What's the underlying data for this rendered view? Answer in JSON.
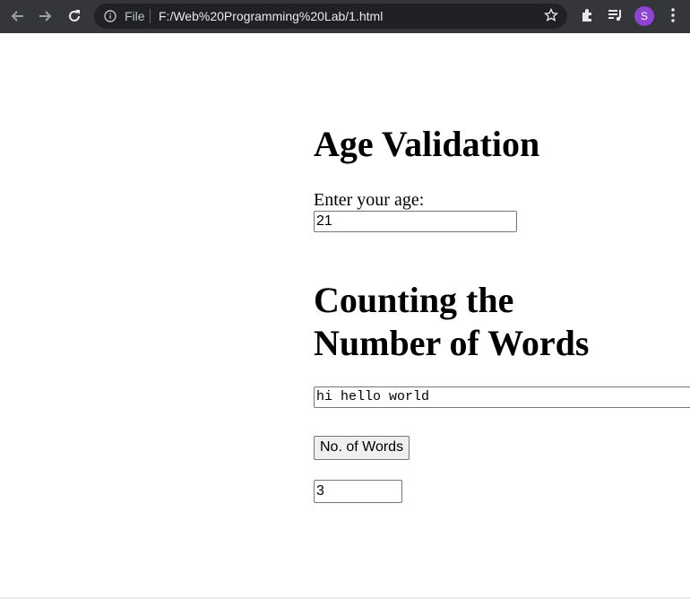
{
  "browser": {
    "file_label": "File",
    "url": "F:/Web%20Programming%20Lab/1.html",
    "avatar_letter": "S",
    "icons": [
      "back-arrow-icon",
      "forward-arrow-icon",
      "reload-icon",
      "info-icon",
      "star-icon",
      "puzzle-icon",
      "media-queue-icon",
      "kebab-menu-icon"
    ]
  },
  "page": {
    "age_heading": "Age Validation",
    "age_label": "Enter your age:",
    "age_value": "21",
    "count_heading": "Counting the Number of Words",
    "text_value": "hi hello world",
    "count_button": "No. of Words",
    "result_value": "3"
  },
  "colors": {
    "chrome_bg": "#35363a",
    "omnibox_bg": "#202124",
    "avatar": "#8e44d0"
  }
}
